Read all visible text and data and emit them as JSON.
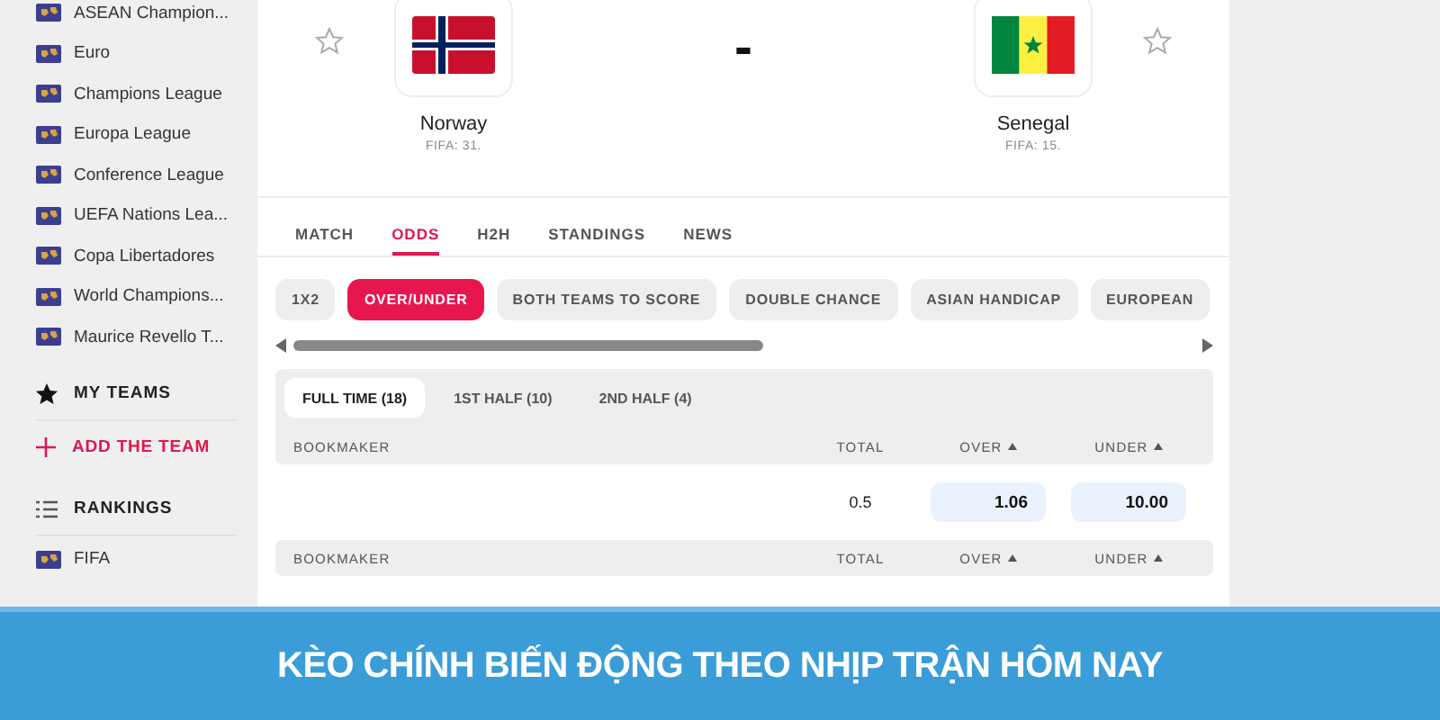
{
  "sidebar": {
    "competitions": [
      "ASEAN Champion...",
      "Euro",
      "Champions League",
      "Europa League",
      "Conference League",
      "UEFA Nations Lea...",
      "Copa Libertadores",
      "World Champions...",
      "Maurice Revello T..."
    ],
    "my_teams": {
      "title": "MY TEAMS",
      "add_label": "ADD THE TEAM"
    },
    "rankings": {
      "title": "RANKINGS",
      "items": [
        "FIFA"
      ]
    }
  },
  "match": {
    "home": {
      "name": "Norway",
      "fifa": "FIFA: 31.",
      "starred": false
    },
    "score": "-",
    "away": {
      "name": "Senegal",
      "fifa": "FIFA: 15.",
      "starred": false
    }
  },
  "tabs": [
    {
      "label": "MATCH",
      "selected": false
    },
    {
      "label": "ODDS",
      "selected": true
    },
    {
      "label": "H2H",
      "selected": false
    },
    {
      "label": "STANDINGS",
      "selected": false
    },
    {
      "label": "NEWS",
      "selected": false
    }
  ],
  "markets": [
    {
      "label": "1X2",
      "selected": false
    },
    {
      "label": "OVER/UNDER",
      "selected": true
    },
    {
      "label": "BOTH TEAMS TO SCORE",
      "selected": false
    },
    {
      "label": "DOUBLE CHANCE",
      "selected": false
    },
    {
      "label": "ASIAN HANDICAP",
      "selected": false
    },
    {
      "label": "EUROPEAN",
      "selected": false
    }
  ],
  "periods": [
    {
      "label": "FULL TIME (18)",
      "selected": true
    },
    {
      "label": "1ST HALF (10)",
      "selected": false
    },
    {
      "label": "2ND HALF (4)",
      "selected": false
    }
  ],
  "tables": [
    {
      "columns": [
        {
          "label": "BOOKMAKER",
          "sortable": false
        },
        {
          "label": "TOTAL",
          "sortable": false
        },
        {
          "label": "OVER",
          "sortable": true
        },
        {
          "label": "UNDER",
          "sortable": true
        }
      ],
      "rows": [
        {
          "total": "0.5",
          "over": "1.06",
          "under": "10.00"
        }
      ]
    },
    {
      "columns": [
        {
          "label": "BOOKMAKER",
          "sortable": false
        },
        {
          "label": "TOTAL",
          "sortable": false
        },
        {
          "label": "OVER",
          "sortable": true
        },
        {
          "label": "UNDER",
          "sortable": true
        }
      ]
    }
  ],
  "banner": {
    "caption": "KÈO CHÍNH BIẾN ĐỘNG THEO NHỊP TRẬN HÔM NAY"
  }
}
